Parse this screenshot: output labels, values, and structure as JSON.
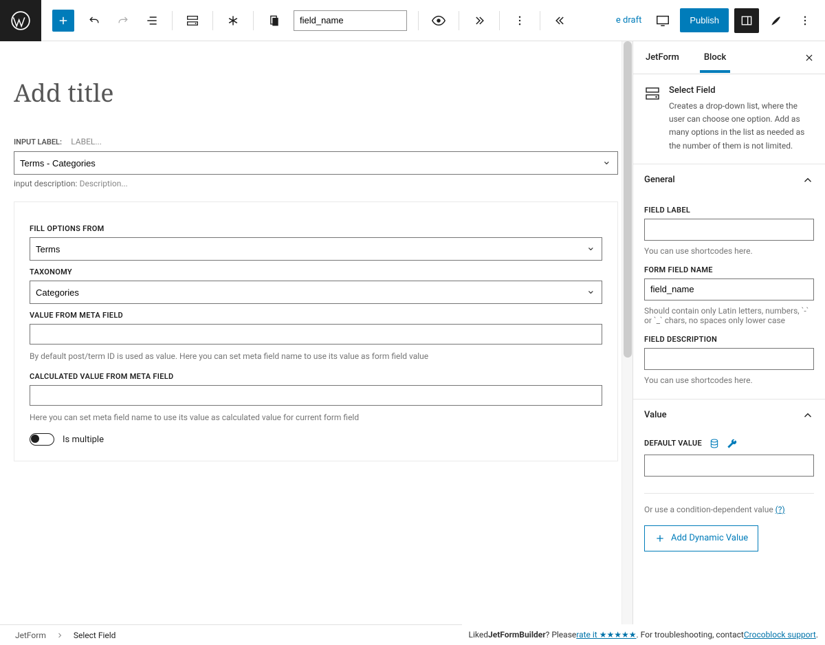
{
  "toolbar": {
    "field_name_value": "field_name",
    "save_draft_text": "e draft",
    "publish_label": "Publish"
  },
  "editor": {
    "title_placeholder": "Add title",
    "input_label_caption": "INPUT LABEL:",
    "input_label_placeholder": "LABEL...",
    "main_select_value": "Terms - Categories",
    "input_desc_caption": "input description:",
    "input_desc_placeholder": "Description...",
    "block": {
      "fill_from_label": "FILL OPTIONS FROM",
      "fill_from_value": "Terms",
      "taxonomy_label": "TAXONOMY",
      "taxonomy_value": "Categories",
      "value_meta_label": "VALUE FROM META FIELD",
      "value_meta_help": "By default post/term ID is used as value. Here you can set meta field name to use its value as form field value",
      "calc_meta_label": "CALCULATED VALUE FROM META FIELD",
      "calc_meta_help": "Here you can set meta field name to use its value as calculated value for current form field",
      "is_multiple_label": "Is multiple"
    }
  },
  "sidebar": {
    "tab1": "JetForm",
    "tab2": "Block",
    "block_title": "Select Field",
    "block_desc": "Creates a drop-down list, where the user can choose one option. Add as many options in the list as needed as the number of them is not limited.",
    "panel_general": "General",
    "field_label_label": "FIELD LABEL",
    "field_label_hint": "You can use shortcodes here.",
    "form_field_name_label": "FORM FIELD NAME",
    "form_field_name_value": "field_name",
    "form_field_name_hint": "Should contain only Latin letters, numbers, `-` or `_` chars, no spaces only lower case",
    "field_desc_label": "FIELD DESCRIPTION",
    "field_desc_hint": "You can use shortcodes here.",
    "panel_value": "Value",
    "default_value_label": "DEFAULT VALUE",
    "cond_text": "Or use a condition-dependent value ",
    "cond_link": "(?)",
    "add_dynamic_label": "Add Dynamic Value"
  },
  "breadcrumb": {
    "root": "JetForm",
    "leaf": "Select Field"
  },
  "notice": {
    "p1": "Liked ",
    "bold": "JetFormBuilder",
    "p2": "? Please ",
    "rate": "rate it ★★★★★",
    "p3": ". For troubleshooting, contact ",
    "support": "Crocoblock support",
    "p4": "."
  }
}
